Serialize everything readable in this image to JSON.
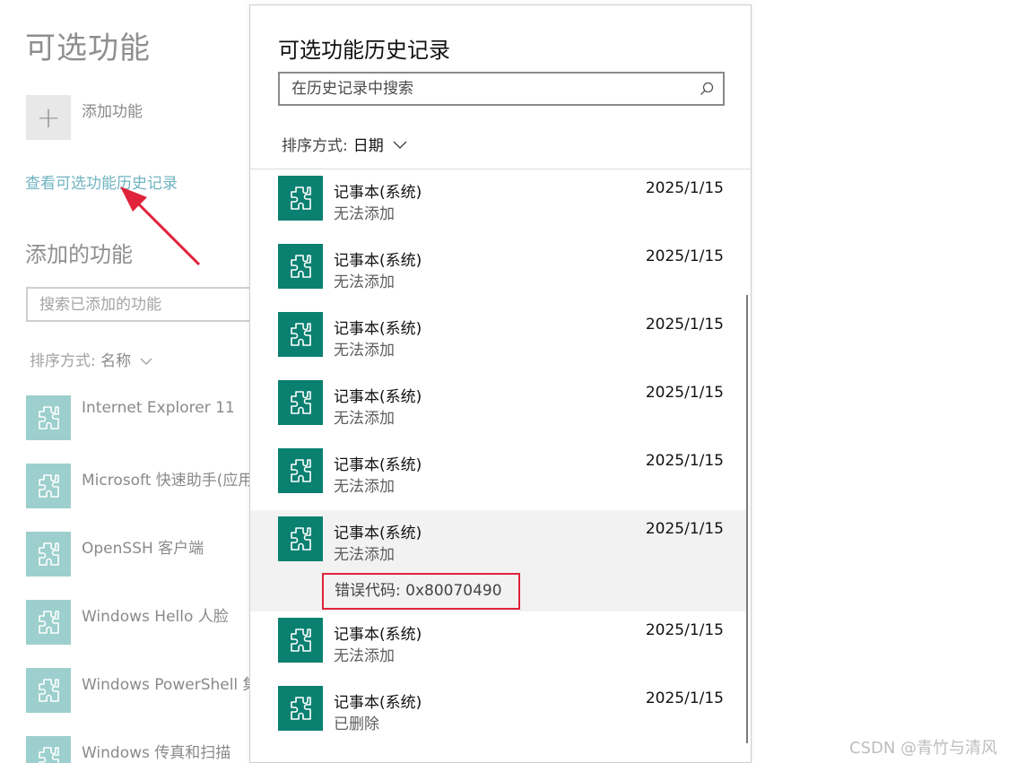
{
  "background": {
    "title": "可选功能",
    "add_feature_label": "添加功能",
    "history_link": "查看可选功能历史记录",
    "added_features_title": "添加的功能",
    "search_placeholder": "搜索已添加的功能",
    "sort_prefix": "排序方式:",
    "sort_value": "名称",
    "features": [
      {
        "label": "Internet Explorer 11"
      },
      {
        "label": "Microsoft 快速助手(应用"
      },
      {
        "label": "OpenSSH 客户端"
      },
      {
        "label": "Windows Hello 人脸"
      },
      {
        "label": "Windows PowerShell 集成"
      },
      {
        "label": "Windows 传真和扫描"
      }
    ]
  },
  "dialog": {
    "title": "可选功能历史记录",
    "search_placeholder": "在历史记录中搜索",
    "sort_prefix": "排序方式:",
    "sort_value": "日期",
    "items": [
      {
        "name": "记事本(系统)",
        "status": "无法添加",
        "date": "2025/1/15"
      },
      {
        "name": "记事本(系统)",
        "status": "无法添加",
        "date": "2025/1/15"
      },
      {
        "name": "记事本(系统)",
        "status": "无法添加",
        "date": "2025/1/15"
      },
      {
        "name": "记事本(系统)",
        "status": "无法添加",
        "date": "2025/1/15"
      },
      {
        "name": "记事本(系统)",
        "status": "无法添加",
        "date": "2025/1/15"
      },
      {
        "name": "记事本(系统)",
        "status": "无法添加",
        "date": "2025/1/15",
        "error": "错误代码: 0x80070490"
      },
      {
        "name": "记事本(系统)",
        "status": "无法添加",
        "date": "2025/1/15"
      },
      {
        "name": "记事本(系统)",
        "status": "已删除",
        "date": "2025/1/15"
      }
    ]
  },
  "watermark": "CSDN @青竹与清风",
  "colors": {
    "accent_link": "#6fb3c1",
    "feature_icon_dialog": "#0a8071",
    "feature_icon_background": "#9ccfcd",
    "error_highlight": "#e0223a",
    "annotation_arrow": "#e0223a"
  }
}
